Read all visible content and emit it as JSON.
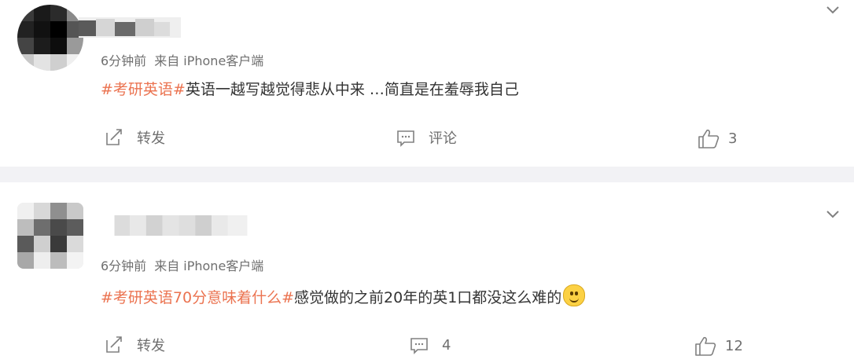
{
  "colors": {
    "tag": "#eb7350",
    "text": "#333333",
    "meta": "#6f6f6f",
    "separator": "#f2f2f5"
  },
  "posts": [
    {
      "time": "6分钟前",
      "source": "来自 iPhone客户端",
      "tag": "#考研英语#",
      "body": "英语一越写越觉得悲从中来 …简直是在羞辱我自己",
      "emoji": "",
      "repost_label": "转发",
      "comment_label": "评论",
      "like_count": "3",
      "icons": {
        "menu": "chevron-down-icon",
        "repost": "repost-icon",
        "comment": "comment-icon",
        "like": "thumbs-up-icon"
      }
    },
    {
      "time": "6分钟前",
      "source": "来自 iPhone客户端",
      "tag": "#考研英语70分意味着什么#",
      "body": "感觉做的之前20年的英1口都没这么难的",
      "emoji": "smile-emoji",
      "repost_label": "转发",
      "comment_count": "4",
      "like_count": "12",
      "icons": {
        "menu": "chevron-down-icon",
        "repost": "repost-icon",
        "comment": "comment-icon",
        "like": "thumbs-up-icon"
      }
    }
  ]
}
